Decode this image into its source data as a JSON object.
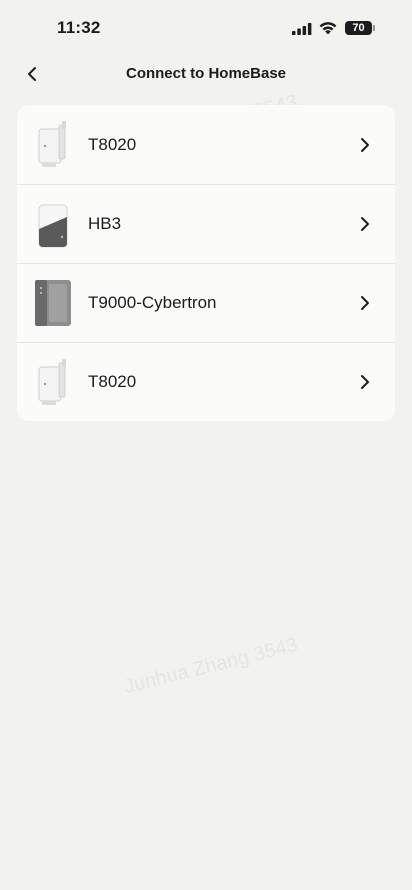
{
  "status_bar": {
    "time": "11:32",
    "battery_level": "70",
    "icons": [
      "signal-icon",
      "wifi-icon",
      "battery-icon"
    ]
  },
  "nav": {
    "title": "Connect to HomeBase",
    "back_icon": "chevron-left-icon"
  },
  "devices": [
    {
      "name": "T8020",
      "icon": "homebase-t8020-icon"
    },
    {
      "name": "HB3",
      "icon": "homebase-hb3-icon"
    },
    {
      "name": "T9000-Cybertron",
      "icon": "homebase-t9000-icon"
    },
    {
      "name": "T8020",
      "icon": "homebase-t8020-icon"
    }
  ],
  "watermark_text": "Junhua Zhang 3543",
  "colors": {
    "background": "#f2f2ee",
    "card": "#fbfbf9",
    "text": "#1c1c1e",
    "divider": "#e6e6e2"
  }
}
